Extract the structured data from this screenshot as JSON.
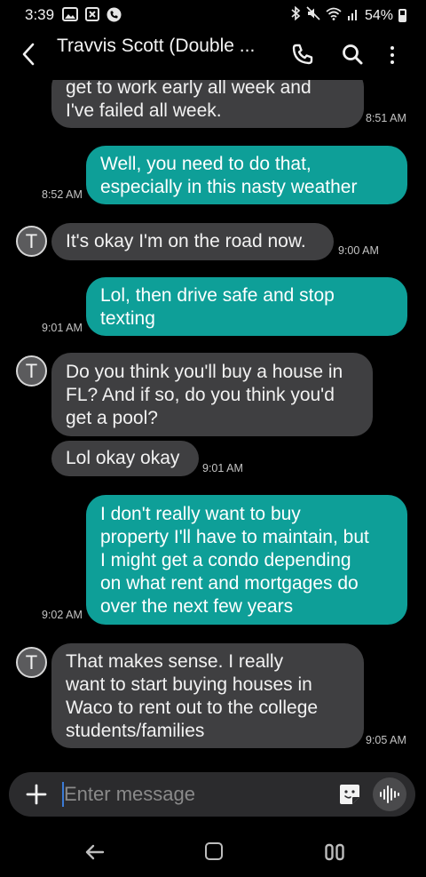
{
  "status_bar": {
    "time": "3:39",
    "battery": "54%",
    "notification_icons": [
      "image-icon",
      "close-box-icon",
      "phone-app-icon"
    ],
    "system_icons": [
      "bluetooth-icon",
      "mute-icon",
      "wifi-icon",
      "signal-icon",
      "battery-icon"
    ]
  },
  "header": {
    "title": "Travvis Scott (Double ...",
    "icons": [
      "back-icon",
      "phone-icon",
      "search-icon",
      "more-vert-icon"
    ]
  },
  "messages": [
    {
      "direction": "in",
      "lines": [
        "get to work early all week and",
        "I've failed all week."
      ],
      "time": "8:51 AM"
    },
    {
      "direction": "out",
      "lines": [
        "Well, you need to do that,",
        "especially in this nasty weather"
      ],
      "time": "8:52 AM"
    },
    {
      "direction": "in",
      "avatar": "T",
      "lines": [
        "It's okay I'm on the road now."
      ],
      "time": "9:00 AM"
    },
    {
      "direction": "out",
      "lines": [
        "Lol, then drive safe and stop",
        "texting"
      ],
      "time": "9:01 AM"
    },
    {
      "direction": "in",
      "avatar": "T",
      "lines": [
        "Do you think you'll buy a house in",
        "FL? And if so, do you think you'd",
        "get a pool?"
      ]
    },
    {
      "direction": "in",
      "lines": [
        "Lol okay okay"
      ],
      "time": "9:01 AM"
    },
    {
      "direction": "out",
      "lines": [
        "I don't really want to buy",
        "property I'll have to maintain, but",
        "I might get a condo depending",
        "on what rent and mortgages do",
        "over the next few years"
      ],
      "time": "9:02 AM"
    },
    {
      "direction": "in",
      "avatar": "T",
      "lines": [
        "That makes sense. I really",
        "want to start buying houses in",
        "Waco to rent out to the college",
        "students/families"
      ],
      "time": "9:05 AM"
    }
  ],
  "composer": {
    "placeholder": "Enter message",
    "icons": [
      "add-icon",
      "sticker-icon",
      "voice-wave-icon"
    ]
  },
  "nav_bar": {
    "icons": [
      "back-arrow-icon",
      "home-icon",
      "recents-icon"
    ]
  },
  "colors": {
    "incoming_bubble": "#3f3f41",
    "outgoing_bubble": "#0e9f98",
    "background": "#000000",
    "caret": "#3b7bd6"
  }
}
